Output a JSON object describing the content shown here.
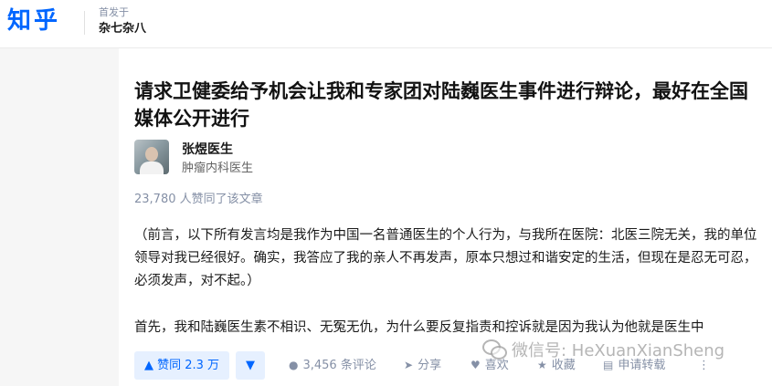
{
  "header": {
    "logo": "知乎",
    "published_label": "首发于",
    "column_name": "杂七杂八"
  },
  "article": {
    "title": "请求卫健委给予机会让我和专家团对陆巍医生事件进行辩论，最好在全国媒体公开进行",
    "author": {
      "name": "张煜医生",
      "title": "肿瘤内科医生"
    },
    "likes_summary": "23,780 人赞同了该文章",
    "paragraphs": [
      "（前言，以下所有发言均是我作为中国一名普通医生的个人行为，与我所在医院：北医三院无关，我的单位领导对我已经很好。确实，我答应了我的亲人不再发声，原本只想过和谐安定的生活，但现在是忍无可忍，必须发声，对不起。）",
      "首先，我和陆巍医生素不相识、无冤无仇，为什么要反复指责和控诉就是因为我认为他就是医生中"
    ]
  },
  "actions": {
    "vote_up": "▲ 赞同 2.3 万",
    "vote_down": "▼",
    "comments": "3,456 条评论",
    "share": "分享",
    "like": "喜欢",
    "favorite": "收藏",
    "reprint": "申请转载",
    "more": "⋮"
  },
  "watermark": {
    "text": "微信号: HeXuanXianSheng"
  },
  "colors": {
    "brand": "#0066ff",
    "vote_bg": "#e6f0ff",
    "muted": "#8590a6"
  }
}
